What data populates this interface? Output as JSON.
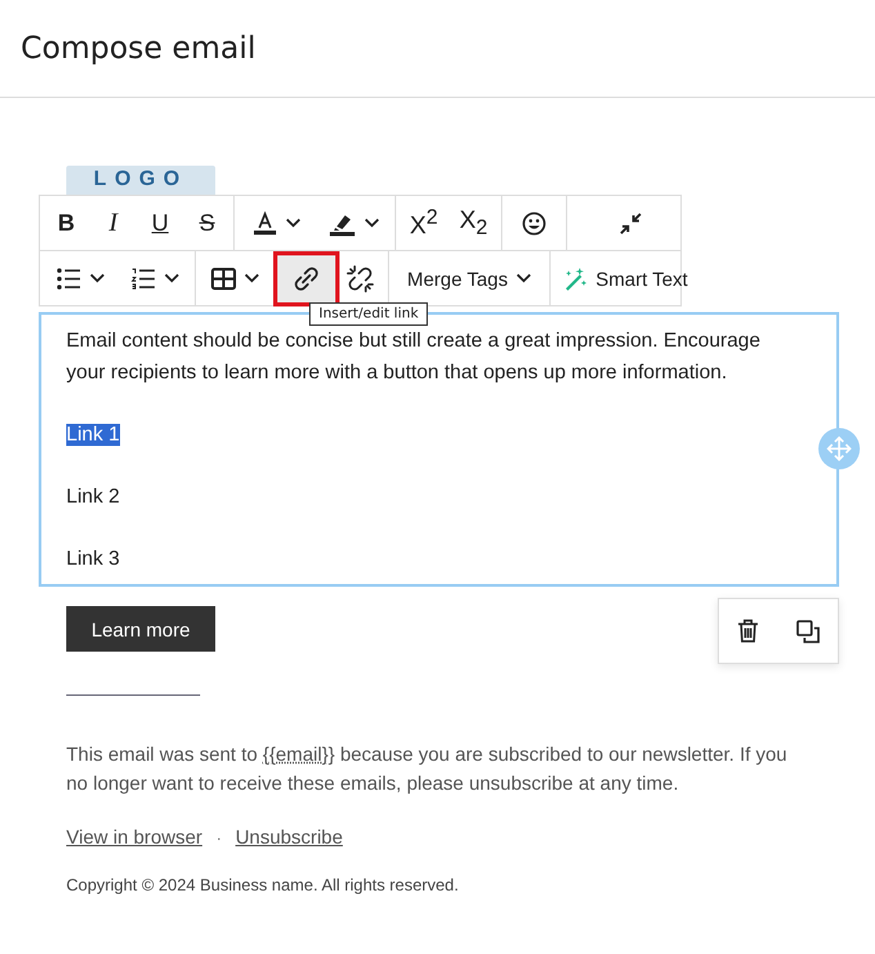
{
  "header": {
    "title": "Compose email"
  },
  "logo": {
    "text": "LOGO"
  },
  "toolbar": {
    "rows": [
      {
        "groups": [
          {
            "buttons": [
              {
                "kind": "bold",
                "label": "B",
                "highlighted": false
              },
              {
                "kind": "italic",
                "label": "I",
                "highlighted": false
              },
              {
                "kind": "underline",
                "label": "U",
                "highlighted": false
              },
              {
                "kind": "strike",
                "label": "S",
                "highlighted": false
              }
            ]
          },
          {
            "buttons": [
              {
                "kind": "textcolor",
                "highlighted": false
              },
              {
                "kind": "highlight",
                "highlighted": false
              }
            ]
          },
          {
            "buttons": [
              {
                "kind": "script",
                "label": "X$^{2}$",
                "highlighted": false
              },
              {
                "kind": "script",
                "label": "X$_{2}$",
                "highlighted": false
              }
            ]
          },
          {
            "buttons": [
              {
                "kind": "emoji",
                "highlighted": false
              }
            ]
          },
          {
            "buttons": [
              {
                "kind": "collapse",
                "highlighted": false
              }
            ]
          }
        ]
      },
      {
        "groups": [
          {
            "buttons": [
              {
                "kind": "bullets",
                "highlighted": false
              },
              {
                "kind": "numbers",
                "highlighted": false
              }
            ]
          },
          {
            "buttons": [
              {
                "kind": "table",
                "highlighted": false
              }
            ]
          },
          {
            "buttons": [
              {
                "kind": "link",
                "highlighted": true
              },
              {
                "kind": "unlink",
                "highlighted": false
              }
            ]
          },
          {
            "buttons": [
              {
                "kind": "menu",
                "label": "Merge Tags",
                "highlighted": false
              }
            ]
          },
          {
            "buttons": [
              {
                "kind": "smart",
                "label": "Smart Text",
                "highlighted": false
              }
            ]
          }
        ]
      }
    ],
    "tooltip": "Insert/edit link"
  },
  "editor": {
    "paragraph": "Email content should be concise but still create a great impression. Encourage your recipients to learn more with a button that opens up more information.",
    "links": [
      {
        "text": "Link 1",
        "selected": true
      },
      {
        "text": "Link 2",
        "selected": false
      },
      {
        "text": "Link 3",
        "selected": false
      }
    ]
  },
  "cta": {
    "label": "Learn more"
  },
  "footer": {
    "before": "This email was sent to ",
    "link": "{{email}}",
    "after": " because you are subscribed to our newsletter. If you no longer want to receive these emails, please unsubscribe at any time.",
    "links": [
      "View in browser",
      "Unsubscribe"
    ],
    "separator": "·",
    "copyright": "Copyright © 2024 Business name. All rights reserved."
  }
}
